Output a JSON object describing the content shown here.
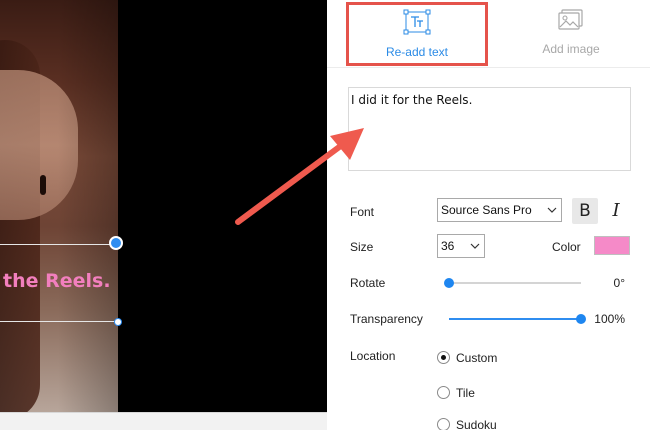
{
  "preview": {
    "overlay_text": "the Reels."
  },
  "tabs": [
    {
      "label": "Re-add text",
      "icon": "text-icon",
      "active": true
    },
    {
      "label": "Add image",
      "icon": "image-icon",
      "active": false
    }
  ],
  "text_input": {
    "value": "I did it for the Reels."
  },
  "font": {
    "label": "Font",
    "value": "Source Sans Pro",
    "bold_label": "B",
    "italic_label": "I"
  },
  "size": {
    "label": "Size",
    "value": "36"
  },
  "color": {
    "label": "Color",
    "value": "#f58ac8"
  },
  "rotate": {
    "label": "Rotate",
    "value_text": "0°",
    "fraction": 0.0
  },
  "transparency": {
    "label": "Transparency",
    "value_text": "100%",
    "fraction": 1.0
  },
  "location": {
    "label": "Location",
    "options": [
      {
        "label": "Custom",
        "selected": true
      },
      {
        "label": "Tile",
        "selected": false
      },
      {
        "label": "Sudoku",
        "selected": false
      }
    ]
  },
  "colors": {
    "accent": "#2b8be6",
    "highlight": "#e5534b",
    "overlay_text": "#f27fbe"
  }
}
